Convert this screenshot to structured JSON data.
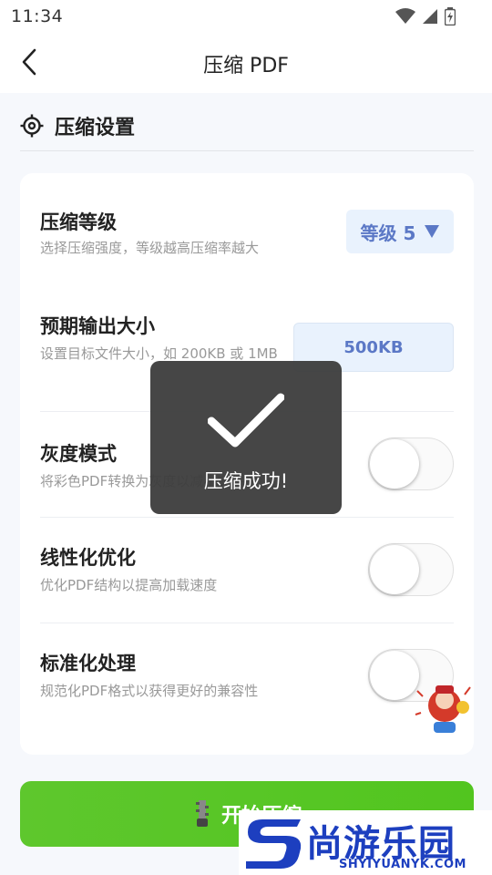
{
  "status_bar": {
    "time": "11:34"
  },
  "app_bar": {
    "title": "压缩 PDF"
  },
  "section": {
    "title": "压缩设置"
  },
  "settings": [
    {
      "title": "压缩等级",
      "desc": "选择压缩强度，等级越高压缩率越大",
      "control": "select",
      "value": "等级 5"
    },
    {
      "title": "预期输出大小",
      "desc": "设置目标文件大小，如 200KB 或 1MB",
      "control": "input",
      "value": "500KB"
    },
    {
      "title": "灰度模式",
      "desc": "将彩色PDF转换为灰度以减小文件大小",
      "control": "toggle",
      "value": false
    },
    {
      "title": "线性化优化",
      "desc": "优化PDF结构以提高加载速度",
      "control": "toggle",
      "value": false
    },
    {
      "title": "标准化处理",
      "desc": "规范化PDF格式以获得更好的兼容性",
      "control": "toggle",
      "value": false
    }
  ],
  "start_button": {
    "label": "开始压缩"
  },
  "toast": {
    "message": "压缩成功!"
  },
  "watermark": {
    "brand": "尚游乐园",
    "url": "SHYIYUANYK.COM"
  },
  "colors": {
    "accent_green": "#52c51f",
    "accent_blue": "#5b78c6",
    "select_bg": "#e9f2fd",
    "toast_bg": "#3c3c3c"
  },
  "icons": {
    "back": "chevron-left-icon",
    "settings": "gear-icon",
    "dropdown": "triangle-down-icon",
    "success": "checkmark-icon",
    "compress": "zipper-icon"
  }
}
